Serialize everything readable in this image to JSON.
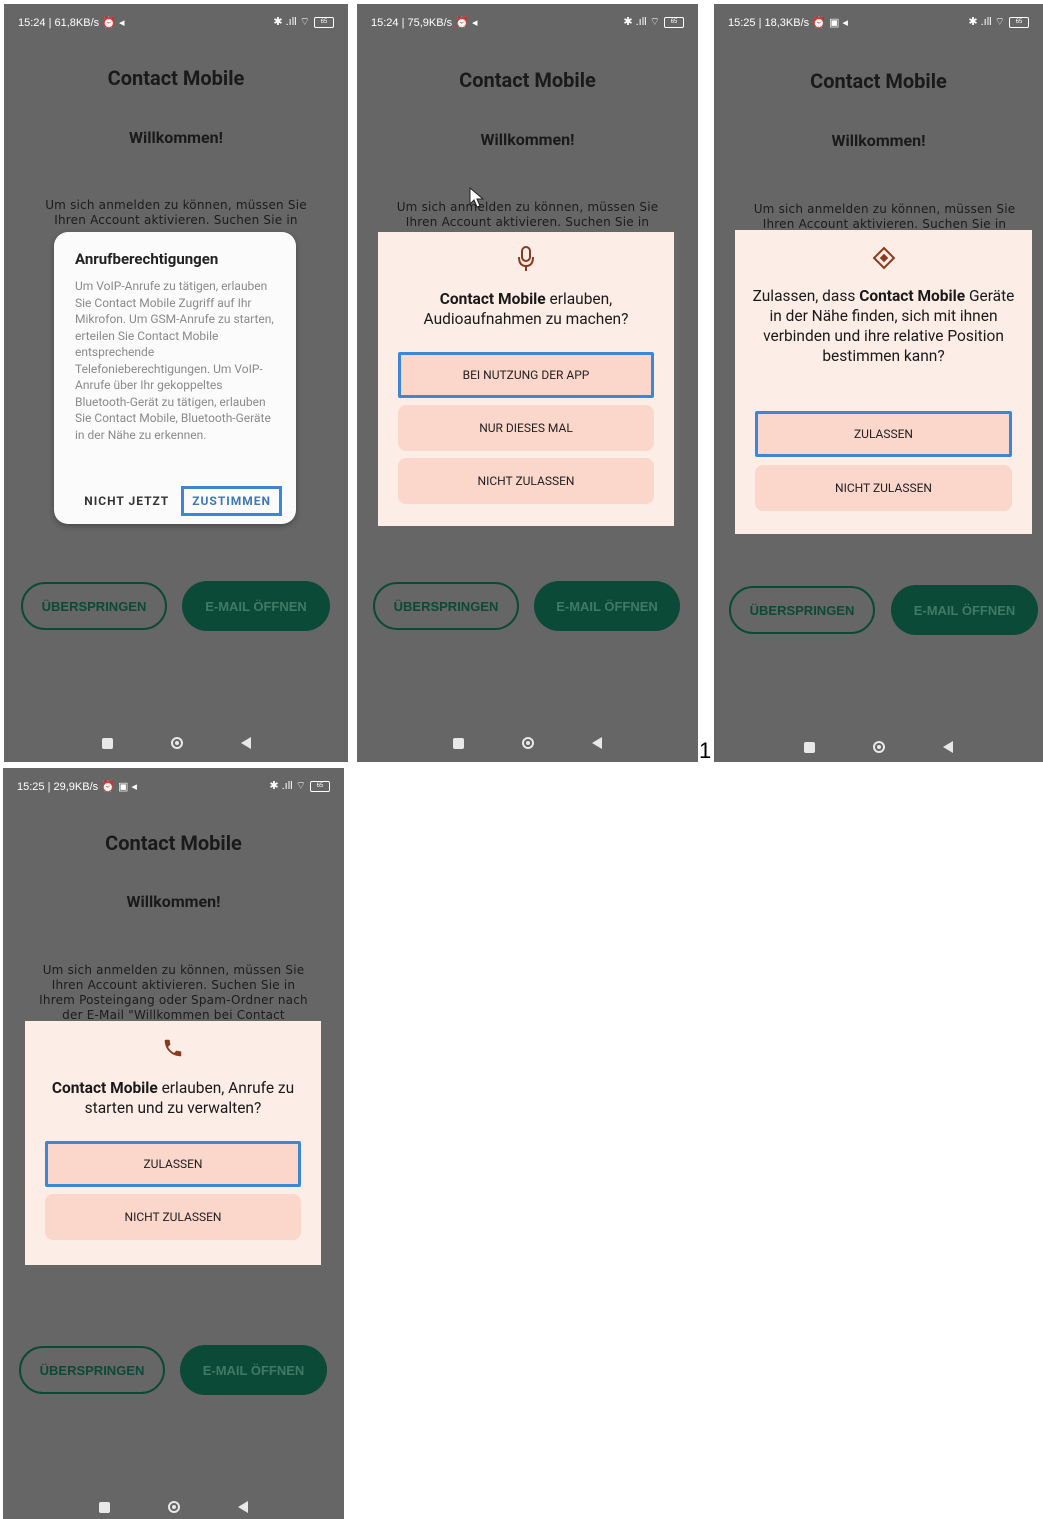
{
  "app": {
    "title": "Contact Mobile",
    "welcome": "Willkommen!"
  },
  "colors": {
    "background": "#666666",
    "primary": "#0b4a36",
    "highlight": "#3b86d6",
    "dialog_peach": "#fcede6",
    "button_peach": "#fbd6ca"
  },
  "buttons": {
    "skip": "ÜBERSPRINGEN",
    "open_mail": "E-MAIL ÖFFNEN"
  },
  "screen_number": "1",
  "screens": [
    {
      "status": {
        "time": "15:24 | 61,8KB/s ⏰ ◂",
        "right": "✱ .ıll ⌔",
        "battery": "65"
      },
      "bg_text": "Um sich anmelden zu können, müssen Sie Ihren Account aktivieren. Suchen Sie in",
      "dialog": {
        "title": "Anrufberechtigungen",
        "body": "Um VoIP-Anrufe zu tätigen, erlauben Sie Contact Mobile Zugriff auf Ihr Mikrofon. Um GSM-Anrufe zu starten, erteilen Sie Contact Mobile entsprechende Telefonieberechtigungen. Um VoIP-Anrufe über Ihr gekoppeltes Bluetooth-Gerät zu tätigen, erlauben Sie Contact Mobile, Bluetooth-Geräte in der Nähe zu erkennen.",
        "deny": "NICHT JETZT",
        "accept": "ZUSTIMMEN"
      }
    },
    {
      "status": {
        "time": "15:24 | 75,9KB/s ⏰ ◂",
        "right": "✱ .ıll ⌔",
        "battery": "65"
      },
      "bg_text": "Um sich anmelden zu können, müssen Sie Ihren Account aktivieren. Suchen Sie in",
      "dialog": {
        "icon": "microphone-icon",
        "app_bold": "Contact Mobile",
        "question_rest": " erlauben, Audioaufnahmen zu machen?",
        "btn1": "BEI NUTZUNG DER APP",
        "btn2": "NUR DIESES MAL",
        "btn3": "NICHT ZULASSEN"
      }
    },
    {
      "status": {
        "time": "15:25 | 18,3KB/s ⏰ ▣ ◂",
        "right": "✱ .ıll ⌔",
        "battery": "65"
      },
      "bg_text": "Um sich anmelden zu können, müssen Sie Ihren Account aktivieren. Suchen Sie in",
      "dialog": {
        "icon": "nearby-devices-icon",
        "question_pre": "Zulassen, dass ",
        "app_bold": "Contact Mobile",
        "question_rest": " Geräte in der Nähe finden, sich mit ihnen verbinden und ihre relative Position bestimmen kann?",
        "btn1": "ZULASSEN",
        "btn2": "NICHT ZULASSEN"
      }
    },
    {
      "status": {
        "time": "15:25 | 29,9KB/s ⏰ ▣ ◂",
        "right": "✱ .ıll ⌔",
        "battery": "65"
      },
      "bg_text": "Um sich anmelden zu können, müssen Sie Ihren Account aktivieren. Suchen Sie in Ihrem Posteingang oder Spam-Ordner nach der E-Mail \"Willkommen bei Contact",
      "dialog": {
        "icon": "phone-icon",
        "app_bold": "Contact Mobile",
        "question_rest": " erlauben, Anrufe zu starten und zu verwalten?",
        "btn1": "ZULASSEN",
        "btn2": "NICHT ZULASSEN"
      }
    }
  ]
}
